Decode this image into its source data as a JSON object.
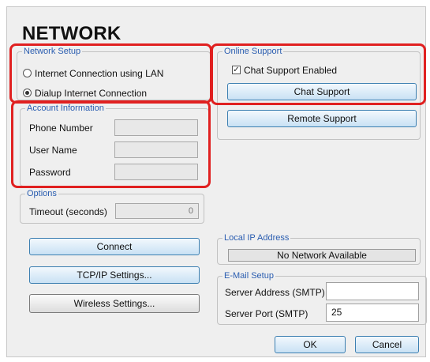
{
  "title": "NETWORK",
  "network_setup": {
    "legend": "Network Setup",
    "options": [
      {
        "label": "Internet Connection using LAN",
        "selected": false
      },
      {
        "label": "Dialup Internet Connection",
        "selected": true
      }
    ]
  },
  "account_information": {
    "legend": "Account Information",
    "phone_label": "Phone Number",
    "phone_value": "",
    "username_label": "User Name",
    "username_value": "",
    "password_label": "Password",
    "password_value": ""
  },
  "options": {
    "legend": "Options",
    "timeout_label": "Timeout (seconds)",
    "timeout_value": "0"
  },
  "buttons": {
    "connect": "Connect",
    "tcpip": "TCP/IP Settings...",
    "wireless": "Wireless Settings...",
    "ok": "OK",
    "cancel": "Cancel"
  },
  "online_support": {
    "legend": "Online Support",
    "chat_enabled_label": "Chat Support Enabled",
    "chat_enabled_checked": true,
    "chat_button": "Chat Support",
    "remote_button": "Remote Support"
  },
  "local_ip": {
    "legend": "Local IP Address",
    "value": "No Network Available"
  },
  "email_setup": {
    "legend": "E-Mail Setup",
    "server_address_label": "Server Address (SMTP)",
    "server_address_value": "",
    "server_port_label": "Server Port (SMTP)",
    "server_port_value": "25"
  },
  "colors": {
    "highlight": "#e02020",
    "legend_text": "#2a5db0"
  }
}
